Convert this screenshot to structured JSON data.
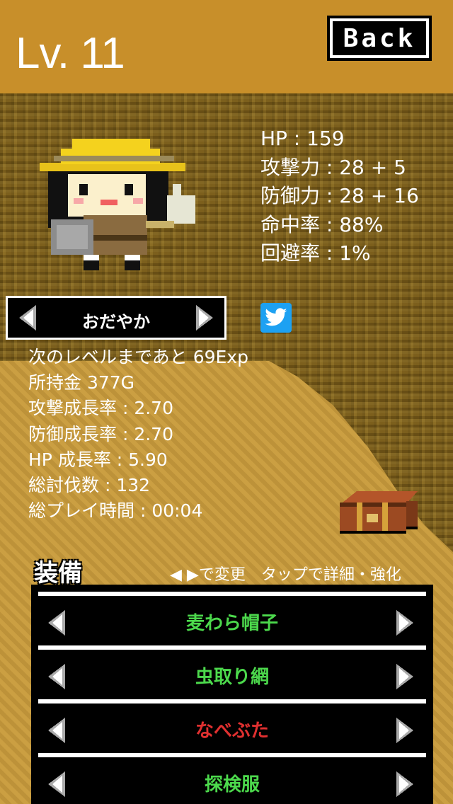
{
  "header": {
    "level": "Lv. 11",
    "back_label": "Back"
  },
  "stats": [
    "HP : 159",
    "攻撃力 : 28 + 5",
    "防御力 : 28 + 16",
    "命中率 : 88%",
    "回避率 : 1%"
  ],
  "personality": {
    "label": "おだやか"
  },
  "info": [
    "次のレベルまであと 69Exp",
    "所持金 377G",
    "攻撃成長率 : 2.70",
    "防御成長率 : 2.70",
    "HP 成長率 : 5.90",
    "総討伐数 : 132",
    "総プレイ時間 : 00:04"
  ],
  "equipment": {
    "title": "装備",
    "hint": "◀ ▶で変更　タップで詳細・強化",
    "items": [
      {
        "name": "麦わら帽子",
        "color": "#4cd94c"
      },
      {
        "name": "虫取り網",
        "color": "#4cd94c"
      },
      {
        "name": "なべぶた",
        "color": "#e03030"
      },
      {
        "name": "探検服",
        "color": "#4cd94c"
      }
    ]
  },
  "icons": {
    "back": "back-button",
    "twitter": "twitter-icon",
    "chest": "treasure-chest-icon",
    "arrows": "arrow-icon"
  }
}
